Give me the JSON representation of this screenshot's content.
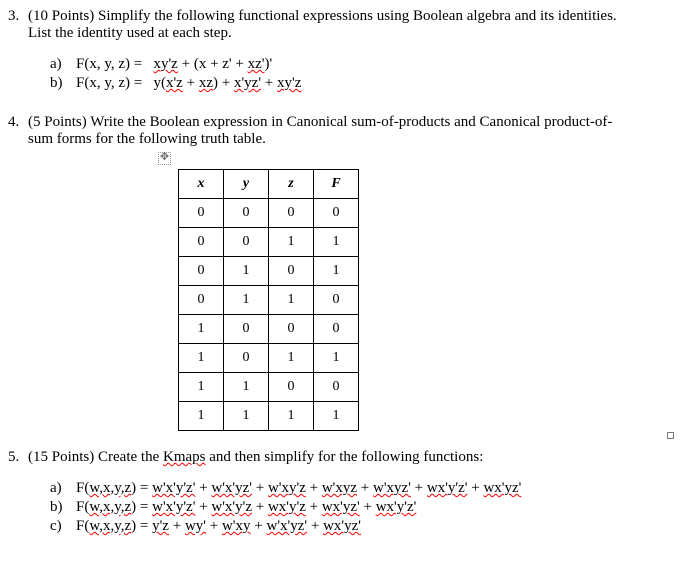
{
  "q3": {
    "num": "3.",
    "prompt_a": "(10 Points) Simplify the following functional expressions using Boolean algebra and its identities.",
    "prompt_b": "List the identity used at each step.",
    "a_letter": "a)",
    "a_label": "F(x, y, z) =   ",
    "a_expr_1": "xy'z",
    "a_expr_2": " + (x + z' + ",
    "a_expr_3": "xz'",
    "a_expr_4": ")'",
    "b_letter": "b)",
    "b_label": "F(x, y, z) =   ",
    "b_expr_1": "y(",
    "b_expr_2": "x'z",
    "b_expr_3": " + ",
    "b_expr_4": "xz",
    "b_expr_5": ") + ",
    "b_expr_6": "x'yz'",
    "b_expr_7": " + ",
    "b_expr_8": "xy'z"
  },
  "q4": {
    "num": "4.",
    "prompt_a": "(5 Points) Write the Boolean expression in Canonical sum-of-products and Canonical product-of-",
    "prompt_b": "sum forms for the following truth table.",
    "move": "✥",
    "headers": [
      "x",
      "y",
      "z",
      "F"
    ],
    "rows": [
      [
        "0",
        "0",
        "0",
        "0"
      ],
      [
        "0",
        "0",
        "1",
        "1"
      ],
      [
        "0",
        "1",
        "0",
        "1"
      ],
      [
        "0",
        "1",
        "1",
        "0"
      ],
      [
        "1",
        "0",
        "0",
        "0"
      ],
      [
        "1",
        "0",
        "1",
        "1"
      ],
      [
        "1",
        "1",
        "0",
        "0"
      ],
      [
        "1",
        "1",
        "1",
        "1"
      ]
    ]
  },
  "q5": {
    "num": "5.",
    "prompt_1": "(15 Points) Create the ",
    "prompt_kmaps": "Kmaps",
    "prompt_2": " and then simplify for the following functions:",
    "a_letter": "a)",
    "a_fn": "F(",
    "a_vars": "w,x,y,z",
    "a_eq": ") = ",
    "a_t1": "w'x'y'z'",
    "a_p1": " + ",
    "a_t2": "w'x'yz'",
    "a_p2": " + ",
    "a_t3": "w'xy'z",
    "a_p3": " + ",
    "a_t4": "w'xyz",
    "a_p4": " + ",
    "a_t5": "w'xyz'",
    "a_p5": " + ",
    "a_t6": "wx'y'z'",
    "a_p6": " + ",
    "a_t7": "wx'yz'",
    "b_letter": "b)",
    "b_fn": "F(",
    "b_vars": "w,x,y,z",
    "b_eq": ") = ",
    "b_t1": "w'x'y'z'",
    "b_p1": " + ",
    "b_t2": "w'x'y'z",
    "b_p2": " + ",
    "b_t3": "wx'y'z",
    "b_p3": " + ",
    "b_t4": "wx'yz'",
    "b_p4": " + ",
    "b_t5": "wx'y'z'",
    "c_letter": "c)",
    "c_fn": "F(",
    "c_vars": "w,x,y,z",
    "c_eq": ") = ",
    "c_t1": "y'z",
    "c_p1": " + ",
    "c_t2": "wy'",
    "c_p2": " + ",
    "c_t3": "w'xy",
    "c_p3": " + ",
    "c_t4": "w'x'yz'",
    "c_p4": " + ",
    "c_t5": "wx'yz'"
  }
}
